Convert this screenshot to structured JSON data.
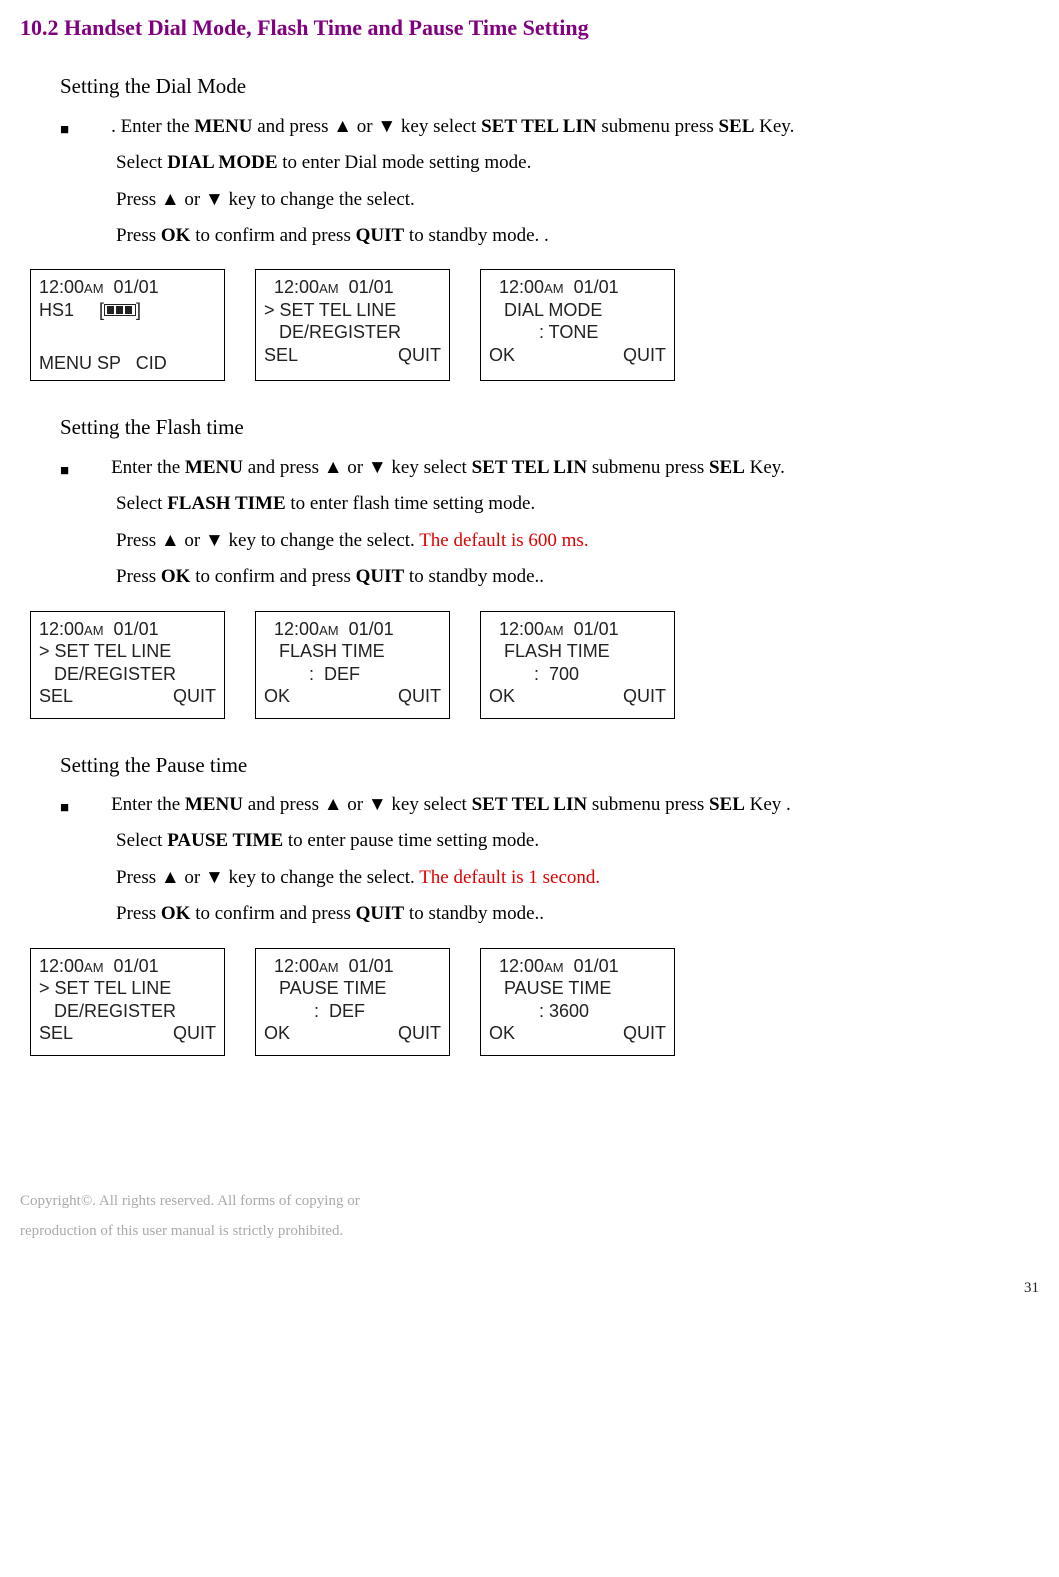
{
  "title": "10.2 Handset Dial Mode, Flash Time and Pause Time Setting",
  "dialmode": {
    "heading": "Setting the Dial Mode",
    "line1_pre": ". Enter the ",
    "menu": "MENU",
    "line1_mid1": " and press ▲ or ▼ key select ",
    "settellin": "SET TEL LIN",
    "line1_mid2": " submenu press ",
    "sel": "SEL",
    "line1_post": " Key.",
    "line2_pre": "Select ",
    "dialmode_bold": "DIAL MODE",
    "line2_post": " to enter Dial mode setting mode.",
    "line3": "Press ▲ or ▼ key to change the select.",
    "line4_pre": "Press ",
    "ok": "OK",
    "line4_mid": " to confirm and press ",
    "quit": "QUIT",
    "line4_post": " to standby mode. ."
  },
  "flashtime": {
    "heading": "Setting the Flash time",
    "line1_pre": "Enter the ",
    "line1_post": " Key.",
    "line2_pre": "Select ",
    "flashtime_bold": "FLASH TIME",
    "line2_post": " to enter flash time setting mode.",
    "line3_pre": "Press ▲ or ▼ key to change the select. ",
    "line3_red": "The default is 600 ms.",
    "line4_pre": "Press ",
    "line4_mid": " to confirm and press ",
    "line4_post": " to standby mode.."
  },
  "pausetime": {
    "heading": "Setting the Pause time",
    "line1_pre": "Enter the ",
    "line1_post": " Key .",
    "line2_pre": "Select ",
    "pausetime_bold": "PAUSE TIME",
    "line2_post": " to enter pause time setting mode.",
    "line3_pre": "Press ▲ or ▼ key to change the select. ",
    "line3_red": "The default is 1 second.",
    "line4_pre": "Press ",
    "line4_mid": " to confirm and press ",
    "line4_post": " to standby mode.."
  },
  "screens1": {
    "s1": {
      "time_a": "12:00",
      "am": "AM",
      "date": "  01/01",
      "l2a": "HS1     [",
      "l2b": "]",
      "menu": "MENU",
      "sp": "SP",
      "cid": "CID"
    },
    "s2": {
      "time_a": "12:00",
      "am": "AM",
      "date": "  01/01",
      "l2": "> SET TEL LINE",
      "l3": "   DE/REGISTER",
      "sel": "SEL",
      "quit": "QUIT"
    },
    "s3": {
      "time_a": "12:00",
      "am": "AM",
      "date": "  01/01",
      "l2": "   DIAL MODE",
      "l3": "          : TONE",
      "ok": "OK",
      "quit": "QUIT"
    }
  },
  "screens2": {
    "s1": {
      "time_a": "12:00",
      "am": "AM",
      "date": "  01/01",
      "l2": "> SET TEL LINE",
      "l3": "   DE/REGISTER",
      "sel": "SEL",
      "quit": "QUIT"
    },
    "s2": {
      "time_a": "12:00",
      "am": "AM",
      "date": "  01/01",
      "l2": "   FLASH TIME",
      "l3": "         :  DEF",
      "ok": "OK",
      "quit": "QUIT"
    },
    "s3": {
      "time_a": "12:00",
      "am": "AM",
      "date": "  01/01",
      "l2": "   FLASH TIME",
      "l3": "         :  700",
      "ok": "OK",
      "quit": "QUIT"
    }
  },
  "screens3": {
    "s1": {
      "time_a": "12:00",
      "am": "AM",
      "date": "  01/01",
      "l2": "> SET TEL LINE",
      "l3": "   DE/REGISTER",
      "sel": "SEL",
      "quit": "QUIT"
    },
    "s2": {
      "time_a": "12:00",
      "am": "AM",
      "date": "  01/01",
      "l2": "   PAUSE TIME",
      "l3": "          :  DEF",
      "ok": "OK",
      "quit": "QUIT"
    },
    "s3": {
      "time_a": "12:00",
      "am": "AM",
      "date": "  01/01",
      "l2": "   PAUSE TIME",
      "l3": "          : 3600",
      "ok": "OK",
      "quit": "QUIT"
    }
  },
  "footer1": "Copyright©. All rights reserved. All forms of copying or",
  "footer2": "reproduction of this user manual is strictly prohibited.",
  "pagenum": "31"
}
